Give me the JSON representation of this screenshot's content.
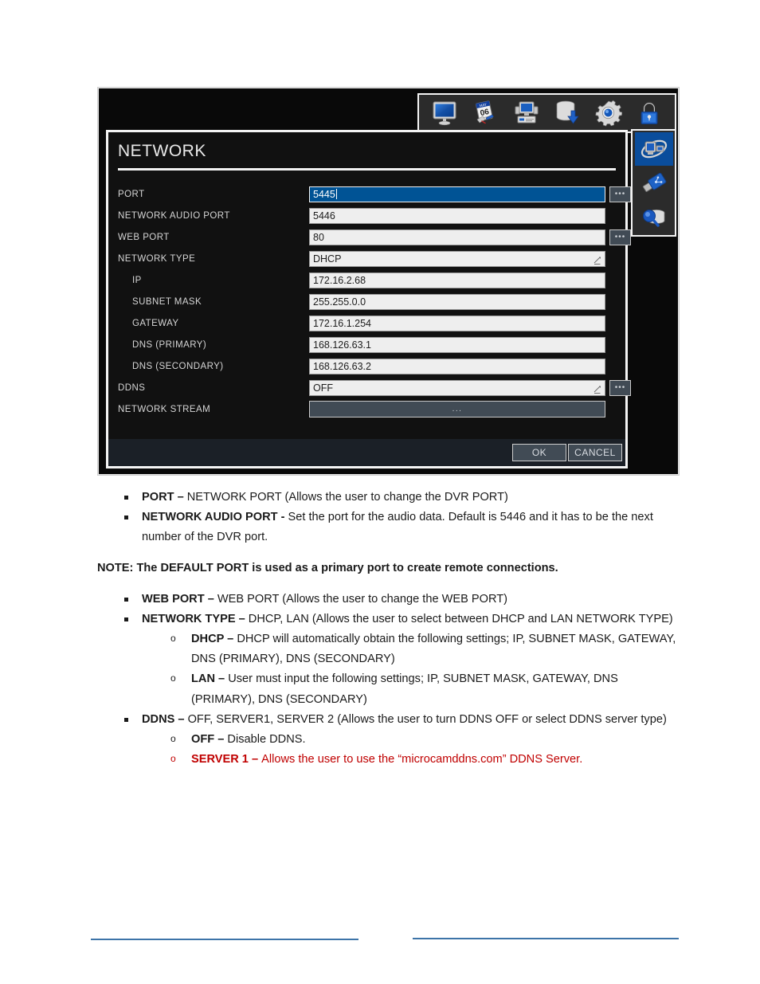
{
  "dvr": {
    "toolbar": {
      "icons": [
        {
          "name": "display-monitor-icon",
          "label": "DISPLAY"
        },
        {
          "name": "schedule-calendar-icon",
          "label": "SCHEDULE"
        },
        {
          "name": "camera-device-icon",
          "label": "CAMERA"
        },
        {
          "name": "backup-database-icon",
          "label": "BACKUP"
        },
        {
          "name": "system-gear-icon",
          "label": "SYSTEM"
        },
        {
          "name": "security-lock-icon",
          "label": "SECURITY"
        }
      ]
    },
    "side_tabs": [
      {
        "name": "network-tab-icon",
        "label": "NETWORK",
        "active": true
      },
      {
        "name": "usb-flash-drive-icon",
        "label": "USB",
        "active": false
      },
      {
        "name": "storage-search-icon",
        "label": "STORAGE SEARCH",
        "active": false
      }
    ],
    "dialog": {
      "title": "NETWORK",
      "rows": [
        {
          "label": "PORT",
          "value": "5445",
          "type": "text",
          "indent": false,
          "focused": true,
          "dots": true,
          "corner": false
        },
        {
          "label": "NETWORK AUDIO PORT",
          "value": "5446",
          "type": "text",
          "indent": false,
          "focused": false,
          "dots": false,
          "corner": false
        },
        {
          "label": "WEB PORT",
          "value": "80",
          "type": "text",
          "indent": false,
          "focused": false,
          "dots": true,
          "corner": false
        },
        {
          "label": "NETWORK TYPE",
          "value": "DHCP",
          "type": "select",
          "indent": false,
          "focused": false,
          "dots": false,
          "corner": true
        },
        {
          "label": "IP",
          "value": "172.16.2.68",
          "type": "text",
          "indent": true,
          "focused": false,
          "dots": false,
          "corner": false
        },
        {
          "label": "SUBNET MASK",
          "value": "255.255.0.0",
          "type": "text",
          "indent": true,
          "focused": false,
          "dots": false,
          "corner": false
        },
        {
          "label": "GATEWAY",
          "value": "172.16.1.254",
          "type": "text",
          "indent": true,
          "focused": false,
          "dots": false,
          "corner": false
        },
        {
          "label": "DNS (PRIMARY)",
          "value": "168.126.63.1",
          "type": "text",
          "indent": true,
          "focused": false,
          "dots": false,
          "corner": false
        },
        {
          "label": "DNS (SECONDARY)",
          "value": "168.126.63.2",
          "type": "text",
          "indent": true,
          "focused": false,
          "dots": false,
          "corner": false
        },
        {
          "label": "DDNS",
          "value": "OFF",
          "type": "select",
          "indent": false,
          "focused": false,
          "dots": true,
          "corner": true
        },
        {
          "label": "NETWORK STREAM",
          "value": "...",
          "type": "button",
          "indent": false,
          "focused": false,
          "dots": false,
          "corner": false
        }
      ],
      "ok_label": "OK",
      "cancel_label": "CANCEL",
      "focus_accent_color": "#005395"
    }
  },
  "doc": {
    "b1_strong": "PORT – ",
    "b1_rest": "NETWORK PORT (Allows the user to change the DVR PORT)",
    "b2_strong": "NETWORK AUDIO PORT - ",
    "b2_rest": "Set the port for the audio data. Default is 5446 and it has to be the next number of the DVR port.",
    "note": "NOTE: The DEFAULT PORT is used as a primary port to create remote connections.",
    "b3_strong": "WEB PORT – ",
    "b3_rest": "WEB PORT (Allows the user to change the WEB PORT)",
    "b4_strong": "NETWORK TYPE – ",
    "b4_rest": "DHCP, LAN (Allows the user to select between DHCP and LAN NETWORK TYPE)",
    "s1_strong": "DHCP – ",
    "s1_rest": "DHCP will automatically obtain the following settings; IP, SUBNET MASK, GATEWAY, DNS (PRIMARY), DNS (SECONDARY)",
    "s2_strong": "LAN – ",
    "s2_rest": "User must input the following settings; IP, SUBNET MASK, GATEWAY, DNS (PRIMARY), DNS (SECONDARY)",
    "b5_strong": "DDNS – ",
    "b5_rest": "OFF, SERVER1, SERVER 2 (Allows the user to turn DDNS OFF or select DDNS server type)",
    "s3_strong": "OFF – ",
    "s3_rest": "Disable DDNS.",
    "s4_strong": "SERVER 1 – ",
    "s4_rest": "Allows the user to use the “microcamddns.com” DDNS Server.",
    "highlight_color": "#c00000"
  }
}
